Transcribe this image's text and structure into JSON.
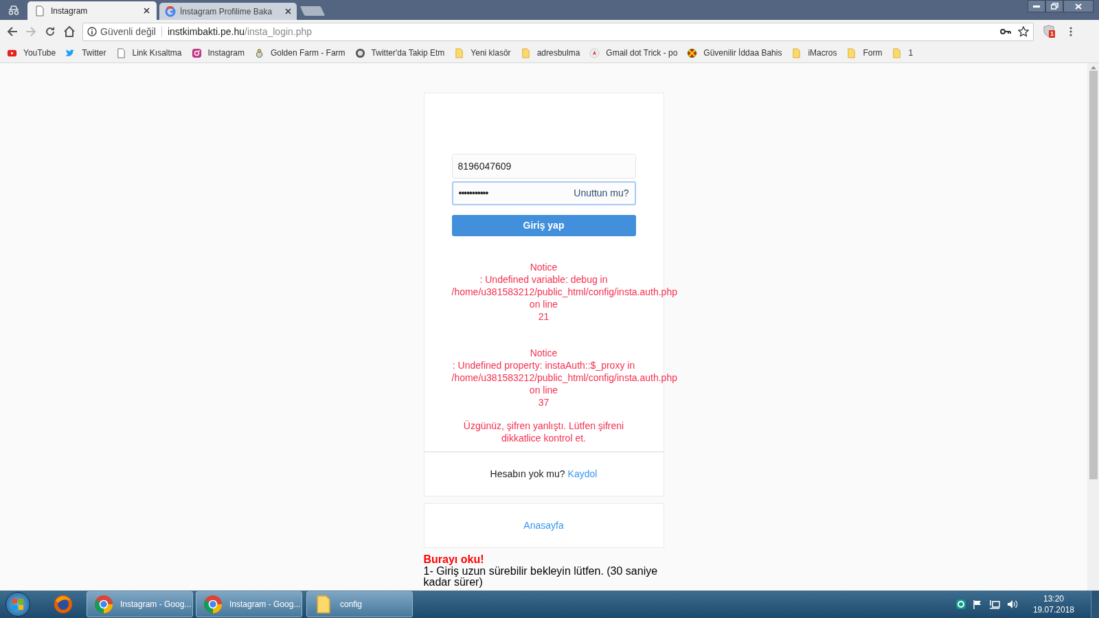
{
  "browser": {
    "tabs": [
      {
        "title": "Instagram",
        "kind": "page",
        "selected": true
      },
      {
        "title": "İnstagram Profilime Baka",
        "kind": "google",
        "selected": false
      }
    ],
    "address_bar": {
      "security": "Güvenli değil",
      "host": "instkimbakti.pe.hu",
      "path": "/insta_login.php"
    },
    "extension_badge": "1",
    "bookmarks": [
      {
        "label": "YouTube",
        "kind": "youtube"
      },
      {
        "label": "Twitter",
        "kind": "twitter"
      },
      {
        "label": "Link Kısaltma",
        "kind": "page"
      },
      {
        "label": "Instagram",
        "kind": "instagram"
      },
      {
        "label": "Golden Farm - Farm",
        "kind": "farm"
      },
      {
        "label": "Twitter'da Takip Etm",
        "kind": "disc"
      },
      {
        "label": "Yeni klasör",
        "kind": "folder"
      },
      {
        "label": "adresbulma",
        "kind": "folder"
      },
      {
        "label": "Gmail dot Trick - po",
        "kind": "arrow"
      },
      {
        "label": "Güvenilir İddaa Bahis",
        "kind": "ball"
      },
      {
        "label": "iMacros",
        "kind": "folder"
      },
      {
        "label": "Form",
        "kind": "folder"
      },
      {
        "label": "1",
        "kind": "folder"
      }
    ]
  },
  "login": {
    "username": "8196047609",
    "password_mask": "•••••••••••",
    "password_focused": true,
    "forgot": "Unuttun mu?",
    "submit": "Giriş yap"
  },
  "notices": [
    {
      "label": "Notice",
      "message": ": Undefined variable: debug in",
      "file": "/home/u381583212/public_html/config/insta.auth.php",
      "on_line": "on line",
      "line": "21"
    },
    {
      "label": "Notice",
      "message": ": Undefined property: instaAuth::$_proxy in",
      "file": "/home/u381583212/public_html/config/insta.auth.php",
      "on_line": "on line",
      "line": "37"
    }
  ],
  "error": "Üzgünüz, şifren yanlıştı. Lütfen şifreni dikkatlice kontrol et.",
  "signup": {
    "prompt": "Hesabın yok mu?",
    "link": "Kaydol"
  },
  "home_link": "Anasayfa",
  "read_me": {
    "title": "Burayı oku!",
    "text": "1- Giriş uzun sürebilir bekleyin lütfen. (30 saniye kadar sürer)"
  },
  "taskbar": {
    "buttons": [
      {
        "label": "Instagram - Goog...",
        "kind": "chrome"
      },
      {
        "label": "Instagram - Goog...",
        "kind": "chrome"
      },
      {
        "label": "config",
        "kind": "folder"
      }
    ],
    "time": "13:20",
    "date": "19.07.2018"
  }
}
